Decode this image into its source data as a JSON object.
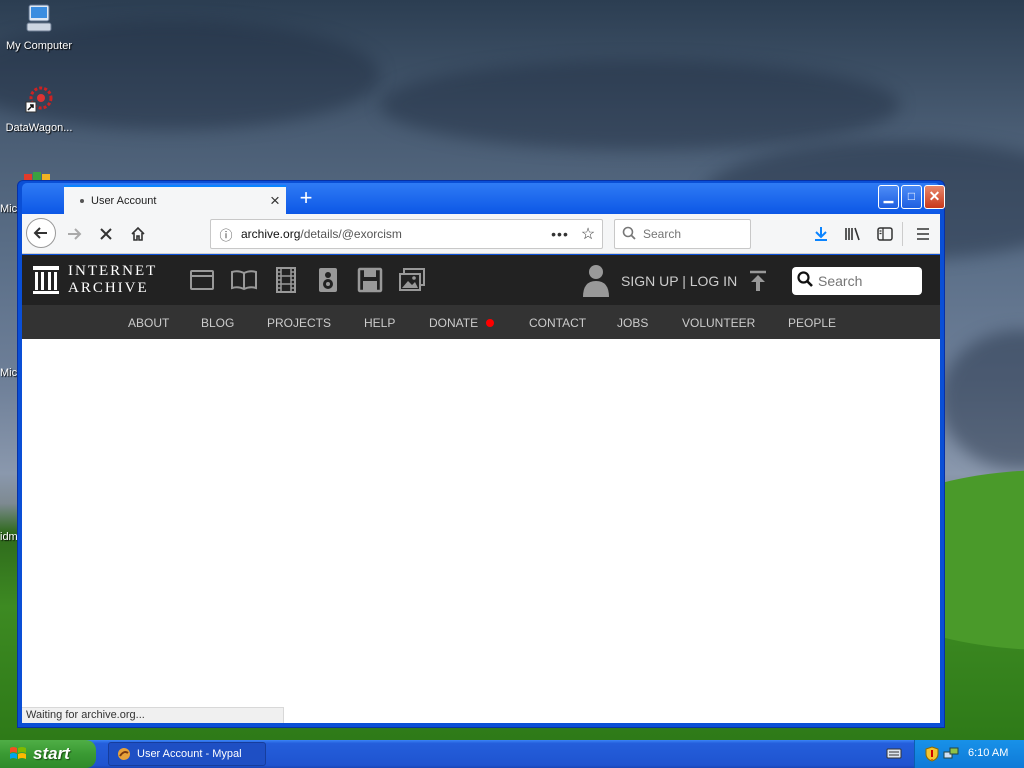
{
  "desktop": {
    "icons": [
      {
        "label": "My Computer"
      },
      {
        "label": "DataWagon..."
      }
    ],
    "partial_labels": [
      "Mic",
      "Mic",
      "idm"
    ]
  },
  "browser": {
    "tab_title": "User Account",
    "url_domain": "archive.org",
    "url_path": "/details/@exorcism",
    "search_placeholder": "Search",
    "status_text": "Waiting for archive.org..."
  },
  "archive": {
    "logo_line1": "INTERNET",
    "logo_line2": "ARCHIVE",
    "signup_login": "SIGN UP | LOG IN",
    "search_placeholder": "Search",
    "nav": [
      "ABOUT",
      "BLOG",
      "PROJECTS",
      "HELP",
      "DONATE",
      "CONTACT",
      "JOBS",
      "VOLUNTEER",
      "PEOPLE"
    ],
    "donate_dot_color": "#ff0000"
  },
  "taskbar": {
    "start_label": "start",
    "task_label": "User Account - Mypal",
    "clock": "6:10 AM"
  }
}
